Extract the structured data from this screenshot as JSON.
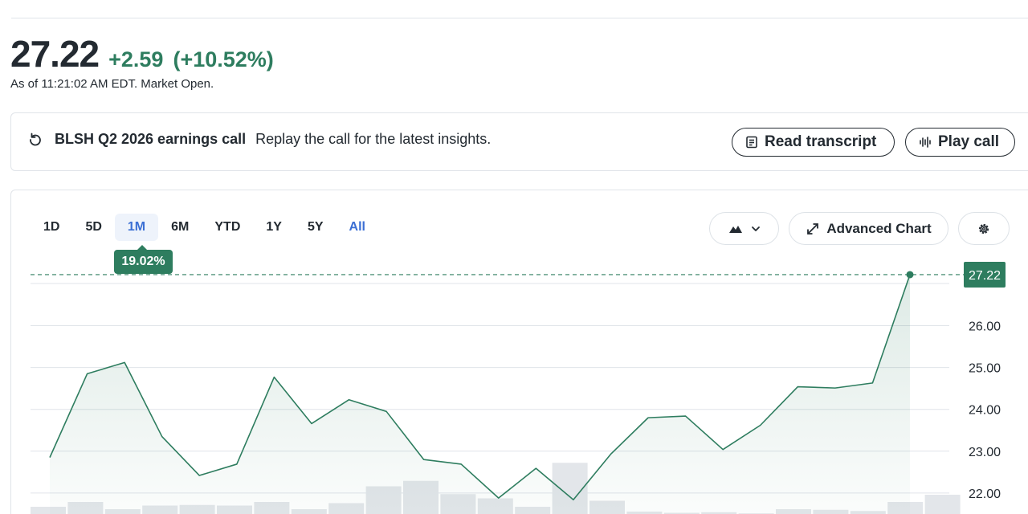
{
  "quote": {
    "price": "27.22",
    "change": "+2.59",
    "change_pct": "(+10.52%)",
    "as_of": "As of 11:21:02 AM EDT. Market Open."
  },
  "earnings": {
    "title": "BLSH Q2 2026 earnings call",
    "subtitle": "Replay the call for the latest insights.",
    "read_label": "Read transcript",
    "play_label": "Play call"
  },
  "ranges": [
    "1D",
    "5D",
    "1M",
    "6M",
    "YTD",
    "1Y",
    "5Y",
    "All"
  ],
  "active_range": "1M",
  "toolbar": {
    "advanced_label": "Advanced Chart"
  },
  "period_change_badge": "19.02%",
  "colors": {
    "up": "#2e7d5f",
    "accent": "#3b6fd4",
    "text": "#232a31",
    "grid": "#e0e4e9",
    "volume": "#e3e6ea"
  },
  "chart_data": {
    "type": "area",
    "y_ticks": [
      "26.00",
      "25.00",
      "24.00",
      "23.00",
      "22.00"
    ],
    "ylim": [
      21.6,
      27.5
    ],
    "last_value_label": "27.22",
    "values": [
      22.85,
      24.85,
      25.12,
      23.35,
      22.42,
      22.69,
      24.77,
      23.66,
      24.23,
      23.95,
      22.8,
      22.69,
      21.88,
      22.59,
      21.84,
      22.93,
      23.8,
      23.84,
      23.04,
      23.62,
      24.54,
      24.51,
      24.63,
      27.22
    ],
    "volume": [
      0.12,
      0.2,
      0.08,
      0.14,
      0.15,
      0.14,
      0.2,
      0.08,
      0.18,
      0.46,
      0.55,
      0.33,
      0.26,
      0.12,
      0.85,
      0.22,
      0.04,
      0.02,
      0.03,
      0.01,
      0.08,
      0.07,
      0.05,
      0.2,
      0.32
    ]
  }
}
